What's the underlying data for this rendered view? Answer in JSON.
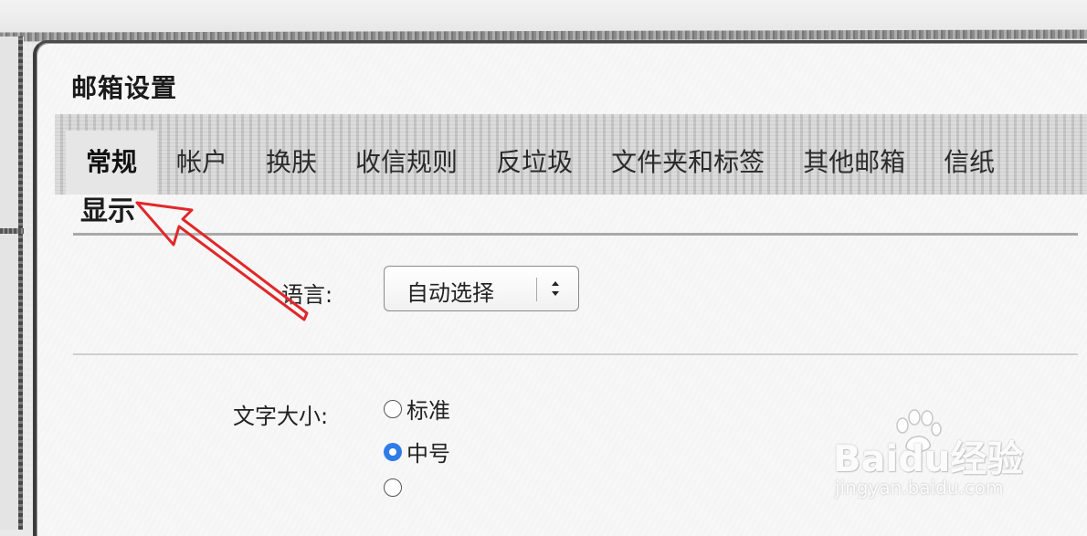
{
  "page": {
    "title": "邮箱设置"
  },
  "tabs": [
    {
      "label": "常规",
      "active": true
    },
    {
      "label": "帐户",
      "active": false
    },
    {
      "label": "换肤",
      "active": false
    },
    {
      "label": "收信规则",
      "active": false
    },
    {
      "label": "反垃圾",
      "active": false
    },
    {
      "label": "文件夹和标签",
      "active": false
    },
    {
      "label": "其他邮箱",
      "active": false
    },
    {
      "label": "信纸",
      "active": false
    }
  ],
  "display": {
    "section_title": "显示",
    "language": {
      "label": "语言:",
      "selected": "自动选择"
    },
    "font_size": {
      "label": "文字大小:",
      "options": [
        {
          "label": "标准",
          "checked": false
        },
        {
          "label": "中号",
          "checked": true
        },
        {
          "label": "",
          "checked": false
        }
      ]
    }
  },
  "watermark": {
    "brand": "Baidu经验",
    "url": "jingyan.baidu.com"
  },
  "colors": {
    "accent_radio": "#2f7be8",
    "annotation_arrow": "#e0282a"
  }
}
